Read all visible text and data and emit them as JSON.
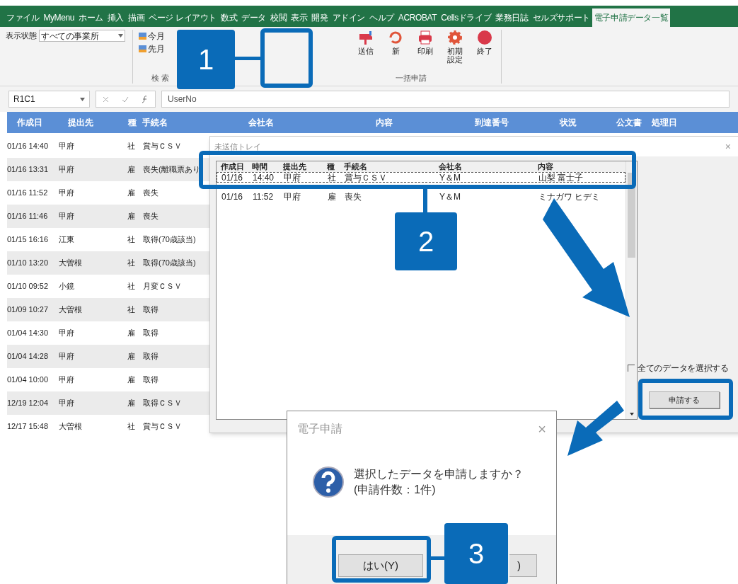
{
  "ribbon_tabs": [
    {
      "label": "ファイル",
      "selected": false
    },
    {
      "label": "MyMenu",
      "selected": false
    },
    {
      "label": "ホーム",
      "selected": false
    },
    {
      "label": "挿入",
      "selected": false
    },
    {
      "label": "描画",
      "selected": false
    },
    {
      "label": "ページ レイアウト",
      "selected": false
    },
    {
      "label": "数式",
      "selected": false
    },
    {
      "label": "データ",
      "selected": false
    },
    {
      "label": "校閲",
      "selected": false
    },
    {
      "label": "表示",
      "selected": false
    },
    {
      "label": "開発",
      "selected": false
    },
    {
      "label": "アドイン",
      "selected": false
    },
    {
      "label": "ヘルプ",
      "selected": false
    },
    {
      "label": "ACROBAT",
      "selected": false
    },
    {
      "label": "Cellsドライブ",
      "selected": false
    },
    {
      "label": "業務日誌",
      "selected": false
    },
    {
      "label": "セルズサポート",
      "selected": false
    },
    {
      "label": "電子申請データ一覧",
      "selected": true
    }
  ],
  "ribbon": {
    "filter_label": "表示状態",
    "filter_value": "すべての事業所",
    "search_buttons": [
      "今月",
      "先月"
    ],
    "search_group": "検 索",
    "send_buttons": [
      {
        "label": "送信",
        "kind": "send"
      },
      {
        "label": "新",
        "kind": "refresh"
      },
      {
        "label": "印刷",
        "kind": "print"
      },
      {
        "label": "初期設定",
        "kind": "settings"
      },
      {
        "label": "終了",
        "kind": "exit"
      }
    ],
    "send_group": "一括申請"
  },
  "formula_bar": {
    "name_box": "R1C1",
    "formula": "UserNo"
  },
  "table": {
    "columns": [
      "作成日",
      "提出先",
      "種",
      "手続名",
      "会社名",
      "内容",
      "到達番号",
      "状況",
      "公文書",
      "処理日"
    ],
    "rows": [
      [
        "01/16 14:40",
        "甲府",
        "社",
        "賞与ＣＳＶ"
      ],
      [
        "01/16 13:31",
        "甲府",
        "雇",
        "喪失(離職票あり"
      ],
      [
        "01/16 11:52",
        "甲府",
        "雇",
        "喪失"
      ],
      [
        "01/16 11:46",
        "甲府",
        "雇",
        "喪失"
      ],
      [
        "01/15 16:16",
        "江東",
        "社",
        "取得(70歳該当)"
      ],
      [
        "01/10 13:20",
        "大曽根",
        "社",
        "取得(70歳該当)"
      ],
      [
        "01/10 09:52",
        "小鏡",
        "社",
        "月変ＣＳＶ"
      ],
      [
        "01/09 10:27",
        "大曽根",
        "社",
        "取得"
      ],
      [
        "01/04 14:30",
        "甲府",
        "雇",
        "取得"
      ],
      [
        "01/04 14:28",
        "甲府",
        "雇",
        "取得"
      ],
      [
        "01/04 10:00",
        "甲府",
        "雇",
        "取得"
      ],
      [
        "12/19 12:04",
        "甲府",
        "雇",
        "取得ＣＳＶ"
      ],
      [
        "12/17 15:48",
        "大曽根",
        "社",
        "賞与ＣＳＶ"
      ]
    ]
  },
  "tray": {
    "title": "未送信トレイ",
    "close": "×",
    "columns": [
      "作成日",
      "時間",
      "提出先",
      "種",
      "手続名",
      "会社名",
      "内容"
    ],
    "rows": [
      {
        "cells": [
          "01/16",
          "14:40",
          "甲府",
          "社",
          "賞与ＣＳＶ",
          "Y＆M",
          "山梨 富士子"
        ],
        "selected": true
      },
      {
        "cells": [
          "01/16",
          "11:52",
          "甲府",
          "雇",
          "喪失",
          "Y＆M",
          "ミナガワ ヒデミ"
        ],
        "selected": false
      }
    ],
    "select_all": {
      "label": "全てのデータを選択する",
      "checked": false
    },
    "submit": "申請する"
  },
  "confirm": {
    "title": "電子申請",
    "close": "×",
    "message": "選択したデータを申請しますか？",
    "count": "(申請件数：1件)",
    "yes": "はい(Y)",
    "no_visible": ")"
  },
  "callouts": [
    "1",
    "2",
    "3"
  ]
}
